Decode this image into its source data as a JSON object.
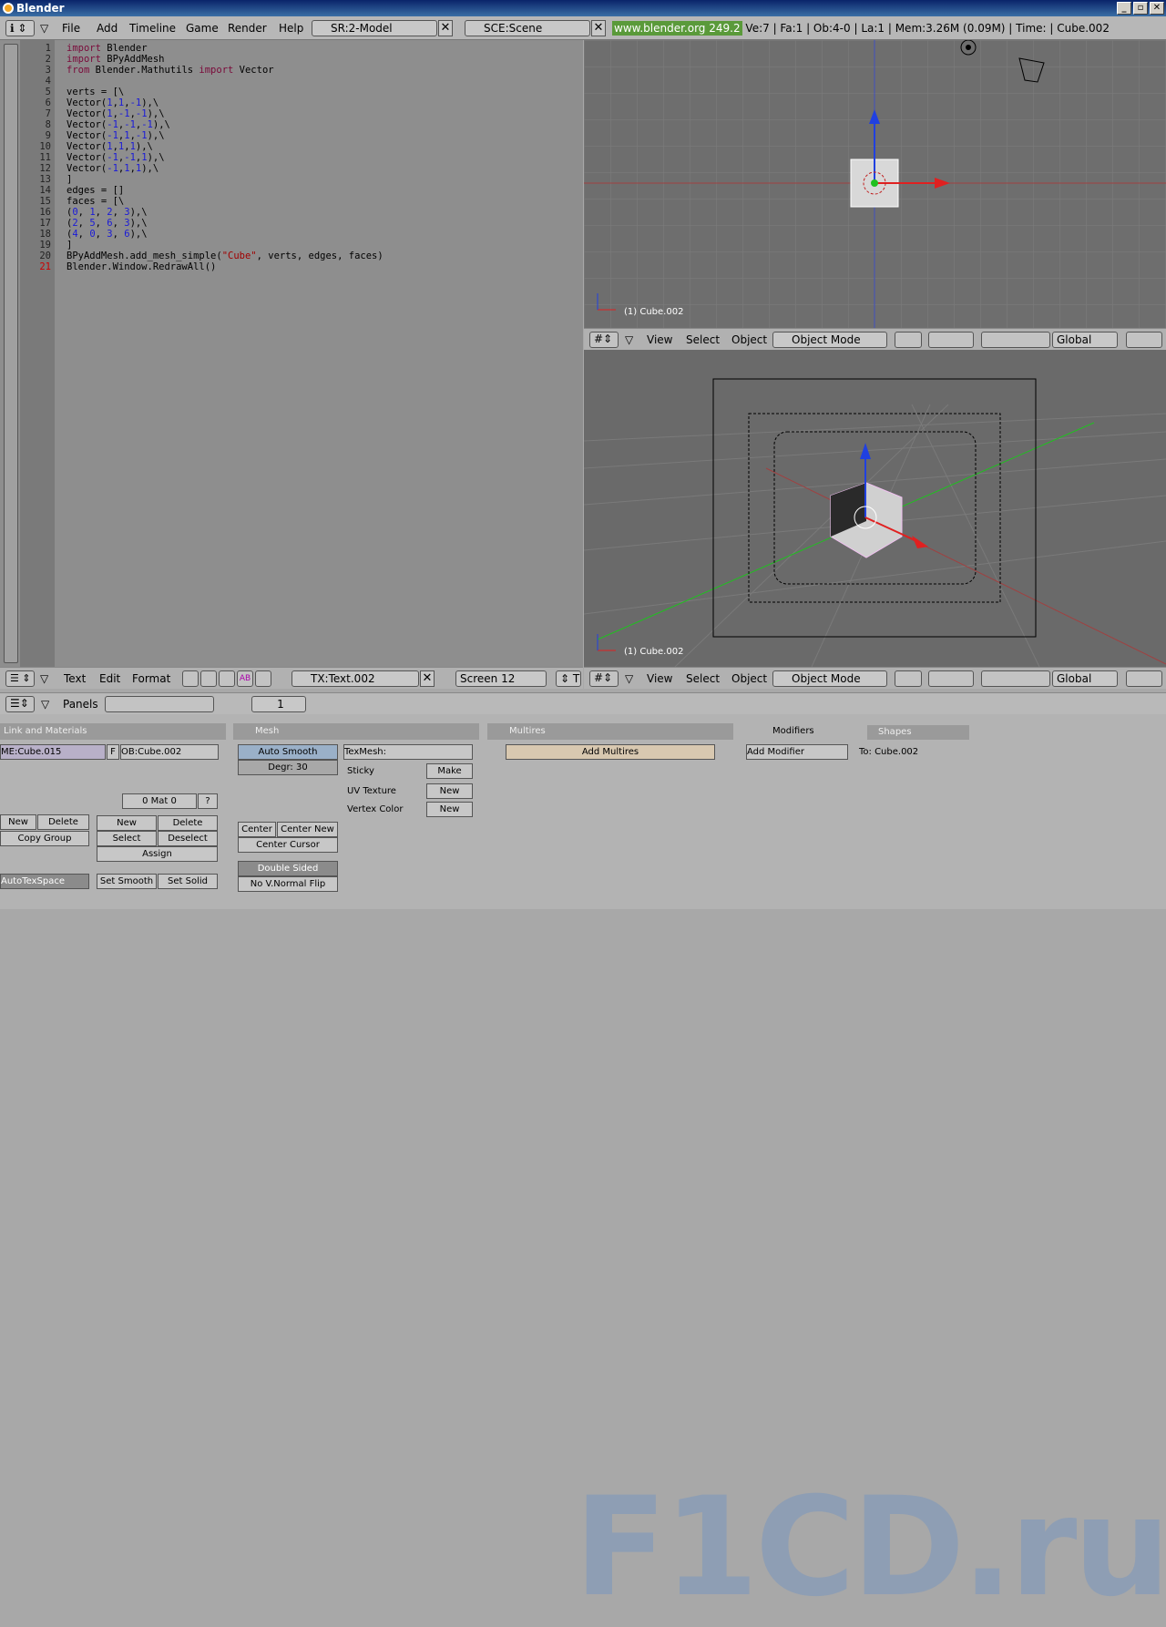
{
  "window": {
    "title": "Blender"
  },
  "topbar": {
    "menus": [
      "File",
      "Add",
      "Timeline",
      "Game",
      "Render",
      "Help"
    ],
    "screen_field": "SR:2-Model",
    "scene_field": "SCE:Scene",
    "website": "www.blender.org 249.2",
    "stats": "Ve:7 | Fa:1 | Ob:4-0 | La:1  | Mem:3.26M (0.09M) | Time: | Cube.002"
  },
  "code": {
    "lines": [
      {
        "n": "1",
        "t": "import Blender"
      },
      {
        "n": "2",
        "t": "import BPyAddMesh"
      },
      {
        "n": "3",
        "t": "from Blender.Mathutils import Vector"
      },
      {
        "n": "4",
        "t": ""
      },
      {
        "n": "5",
        "t": "verts = [\\"
      },
      {
        "n": "6",
        "t": "Vector(1,1,-1),\\"
      },
      {
        "n": "7",
        "t": "Vector(1,-1,-1),\\"
      },
      {
        "n": "8",
        "t": "Vector(-1,-1,-1),\\"
      },
      {
        "n": "9",
        "t": "Vector(-1,1,-1),\\"
      },
      {
        "n": "10",
        "t": "Vector(1,1,1),\\"
      },
      {
        "n": "11",
        "t": "Vector(-1,-1,1),\\"
      },
      {
        "n": "12",
        "t": "Vector(-1,1,1),\\"
      },
      {
        "n": "13",
        "t": "]"
      },
      {
        "n": "14",
        "t": "edges = []"
      },
      {
        "n": "15",
        "t": "faces = [\\"
      },
      {
        "n": "16",
        "t": "(0, 1, 2, 3),\\"
      },
      {
        "n": "17",
        "t": "(2, 5, 6, 3),\\"
      },
      {
        "n": "18",
        "t": "(4, 0, 3, 6),\\"
      },
      {
        "n": "19",
        "t": "]"
      },
      {
        "n": "20",
        "t": "BPyAddMesh.add_mesh_simple(\"Cube\", verts, edges, faces)"
      },
      {
        "n": "21",
        "t": "Blender.Window.RedrawAll()"
      }
    ]
  },
  "text_header": {
    "menus": [
      "Text",
      "Edit",
      "Format"
    ],
    "text_field": "TX:Text.002",
    "screen_size": "Screen 12"
  },
  "view3d": {
    "object_label": "(1) Cube.002",
    "menus": [
      "View",
      "Select",
      "Object"
    ],
    "mode": "Object Mode",
    "orientation": "Global"
  },
  "props_header": {
    "label": "Panels",
    "frame": "1"
  },
  "panels": {
    "link": {
      "title": "Link and Materials",
      "me": "ME:Cube.015",
      "f": "F",
      "ob": "OB:Cube.002",
      "mat": "0 Mat 0",
      "q": "?",
      "new": "New",
      "delete": "Delete",
      "copy_group": "Copy Group",
      "new2": "New",
      "delete2": "Delete",
      "select": "Select",
      "deselect": "Deselect",
      "assign": "Assign",
      "autotex": "AutoTexSpace",
      "set_smooth": "Set Smooth",
      "set_solid": "Set Solid"
    },
    "mesh": {
      "title": "Mesh",
      "auto_smooth": "Auto Smooth",
      "degr": "Degr: 30",
      "texmesh": "TexMesh:",
      "sticky": "Sticky",
      "make": "Make",
      "uv_texture": "UV Texture",
      "new": "New",
      "vertex_color": "Vertex Color",
      "new2": "New",
      "center": "Center",
      "center_new": "Center New",
      "center_cursor": "Center Cursor",
      "double_sided": "Double Sided",
      "no_vnormal_flip": "No V.Normal Flip"
    },
    "multires": {
      "title": "Multires",
      "add": "Add Multires"
    },
    "modifiers": {
      "title": "Modifiers",
      "shapes": "Shapes",
      "add": "Add Modifier",
      "to": "To: Cube.002"
    }
  },
  "watermark": "F1CD.ru",
  "colors": {
    "accent_blue": "#0a246a",
    "x_axis": "#e02020",
    "y_axis": "#20c020",
    "z_axis": "#2040e0"
  }
}
